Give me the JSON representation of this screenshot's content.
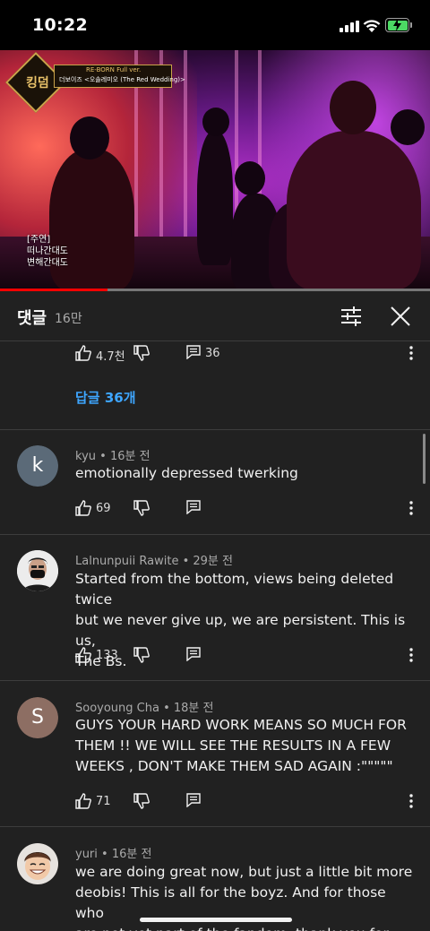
{
  "status_bar": {
    "time": "10:22"
  },
  "video": {
    "logo": "킹덤",
    "banner_line1": "RE-BORN Full ver.",
    "banner_line2": "더보이즈 <오솔레미오 (The Red Wedding)>",
    "caption_line1": "[주연]",
    "caption_line2": "떠나간대도",
    "caption_line3": "변해간대도",
    "progress_fraction": 0.25
  },
  "panel": {
    "title": "댓글",
    "count": "16만"
  },
  "prev_comment": {
    "likes": "4.7천",
    "replies": "36",
    "replies_link": "답글 36개"
  },
  "comments": [
    {
      "avatar_letter": "k",
      "avatar_color": "#5b6a78",
      "author": "kyu",
      "time": "16분 전",
      "lines": [
        "emotionally depressed twerking"
      ],
      "likes": "69"
    },
    {
      "avatar_letter": "",
      "avatar_color": "#e8e8e8",
      "author": "Lalnunpuii Rawite",
      "time": "29분 전",
      "lines": [
        "Started from the bottom, views being deleted twice",
        "but we never give up, we are persistent. This is us,",
        "The Bs."
      ],
      "likes": "133"
    },
    {
      "avatar_letter": "S",
      "avatar_color": "#8d6e63",
      "author": "Sooyoung Cha",
      "time": "18분 전",
      "lines": [
        "GUYS YOUR HARD WORK MEANS SO MUCH FOR",
        "THEM !! WE WILL SEE THE RESULTS IN A FEW",
        "WEEKS , DON'T MAKE THEM SAD AGAIN :\"\"\"\"\""
      ],
      "likes": "71"
    },
    {
      "avatar_letter": "",
      "avatar_color": "#d9d9d9",
      "author": "yuri",
      "time": "16분 전",
      "lines": [
        "we are doing great now, but just a little bit more",
        "deobis! This is all for the boyz. And for those who",
        "are not yet part of the fandom, thank you for being"
      ],
      "likes": ""
    }
  ],
  "sep": " • ",
  "icons": [
    "thumbs-up-icon",
    "thumbs-down-icon",
    "reply-icon",
    "more-vert-icon",
    "filter-icon",
    "close-icon"
  ]
}
